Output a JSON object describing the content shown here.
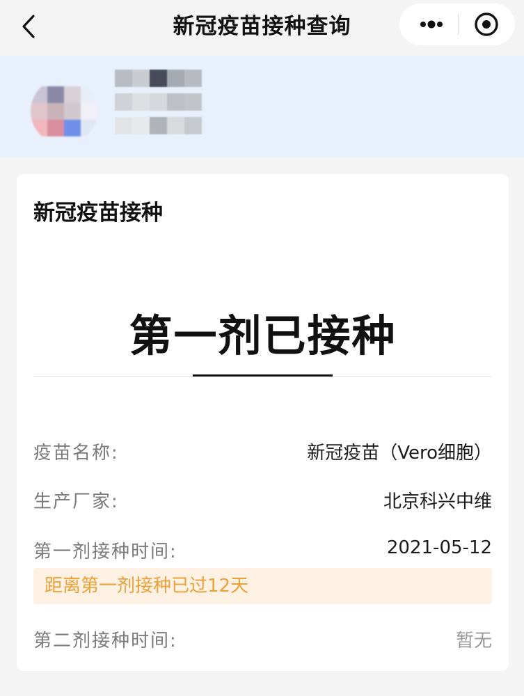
{
  "navbar": {
    "title": "新冠疫苗接种查询",
    "back_icon": "chevron-left-icon",
    "more_icon": "more-dots-icon",
    "close_icon": "target-circle-icon"
  },
  "profile": {
    "avatar_pixels": [
      "#c9c3d6",
      "#8a8aa8",
      "#d9d0d8",
      "#e8eef8",
      "#e0c6cc",
      "#c8b4b8",
      "#d2c8d0",
      "#f0f0f6",
      "#f2b6bd",
      "#d98ea0",
      "#6f8fe8",
      "#dfe6f4"
    ],
    "name_pixels": [
      "#b8bcc2",
      "#c9ccd0",
      "#484c5a",
      "#a6aab2",
      "#b7bbc1",
      "#cfd2d6",
      "#dcdfe2",
      "#d5d8dc",
      "#bdc0c6",
      "#c2c5ca",
      "#e2e4e7",
      "#e8e9ec",
      "#b0b3b9",
      "#d8dbde",
      "#c6c9cd"
    ]
  },
  "card": {
    "title": "新冠疫苗接种",
    "status": "第一剂已接种",
    "rows": [
      {
        "label": "疫苗名称:",
        "value": "新冠疫苗（Vero细胞）"
      },
      {
        "label": "生产厂家:",
        "value": "北京科兴中维"
      },
      {
        "label": "第一剂接种时间:",
        "value": "2021-05-12"
      },
      {
        "label": "第二剂接种时间:",
        "value": "暂无"
      }
    ],
    "notice": "距离第一剂接种已过12天"
  },
  "colors": {
    "background": "#f4f4f4",
    "banner": "#e8f1fb",
    "notice_bg": "#fdf1e3",
    "notice_text": "#e9a13a",
    "label_text": "#7a7a7a"
  }
}
